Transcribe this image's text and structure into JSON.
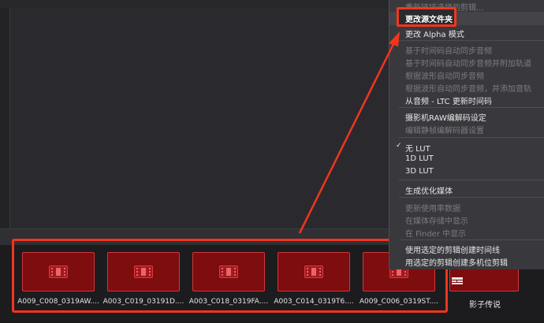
{
  "colors": {
    "annotation": "#f2351e",
    "clip_fill": "#7d0d0f",
    "clip_border": "#d2353b",
    "menu_bg": "#39393d"
  },
  "context_menu": {
    "items": [
      {
        "label": "重新链接选择的剪辑...",
        "enabled": false,
        "partial": true
      },
      {
        "label": "更改源文件夹",
        "enabled": true,
        "highlighted": true
      },
      {
        "label": "更改 Alpha 模式",
        "enabled": true
      },
      {
        "label": "基于时间码自动同步音频",
        "enabled": false
      },
      {
        "label": "基于时间码自动同步音频并附加轨道",
        "enabled": false
      },
      {
        "label": "根据波形自动同步音频",
        "enabled": false
      },
      {
        "label": "根据波形自动同步音频，并添加音轨",
        "enabled": false
      },
      {
        "label": "从音频 - LTC 更新时间码",
        "enabled": true
      },
      {
        "label": "摄影机RAW编解码设定",
        "enabled": true
      },
      {
        "label": "编辑静帧编解码器设置",
        "enabled": false
      },
      {
        "label": "无 LUT",
        "enabled": true,
        "checked": true
      },
      {
        "label": "1D LUT",
        "enabled": true
      },
      {
        "label": "3D LUT",
        "enabled": true
      },
      {
        "label": "生成优化媒体",
        "enabled": true
      },
      {
        "label": "更新使用率数据",
        "enabled": false
      },
      {
        "label": "在媒体存储中显示",
        "enabled": false
      },
      {
        "label": "在 Finder 中显示",
        "enabled": false
      },
      {
        "label": "使用选定的剪辑创建时间线",
        "enabled": true
      },
      {
        "label": "用选定的剪辑创建多机位剪辑",
        "enabled": true
      }
    ],
    "check_mark": "✓"
  },
  "media_pool": {
    "clips": [
      {
        "name": "A009_C008_0319AW...."
      },
      {
        "name": "A003_C019_03191D...."
      },
      {
        "name": "A003_C018_0319FA...."
      },
      {
        "name": "A003_C014_0319T6...."
      },
      {
        "name": "A009_C006_0319ST...."
      }
    ],
    "timeline": {
      "name": "影子传说",
      "icon": "timeline-icon"
    },
    "clip_icon": "film-strip-icon"
  }
}
